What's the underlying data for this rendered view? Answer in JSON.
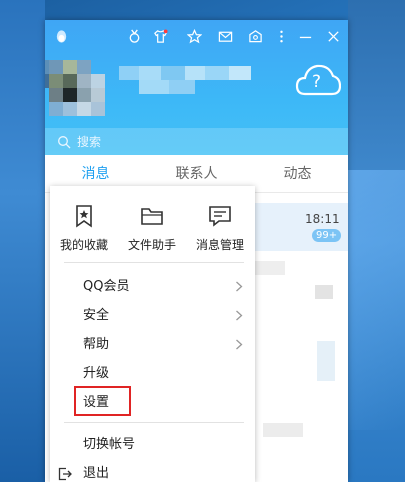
{
  "window": {
    "titlebar_icons": [
      "penguin-icon",
      "medal-icon",
      "shirt-icon",
      "star-icon",
      "mail-icon",
      "app-box-icon",
      "more-icon",
      "minimize-icon",
      "close-icon"
    ],
    "weather_label": "?"
  },
  "search": {
    "placeholder": "搜索"
  },
  "tabs": [
    {
      "label": "消息",
      "active": true
    },
    {
      "label": "联系人",
      "active": false
    },
    {
      "label": "动态",
      "active": false
    }
  ],
  "conversation": {
    "time": "18:11",
    "unread": "99+"
  },
  "menu": {
    "quick_actions": [
      {
        "label": "我的收藏",
        "icon": "bookmark-icon"
      },
      {
        "label": "文件助手",
        "icon": "folder-icon"
      },
      {
        "label": "消息管理",
        "icon": "message-manage-icon"
      }
    ],
    "items": [
      {
        "label": "QQ会员",
        "has_submenu": true
      },
      {
        "label": "安全",
        "has_submenu": true
      },
      {
        "label": "帮助",
        "has_submenu": true
      },
      {
        "label": "升级",
        "has_submenu": false
      },
      {
        "label": "设置",
        "has_submenu": false,
        "highlighted": true
      },
      {
        "label": "切换帐号",
        "has_submenu": false
      },
      {
        "label": "退出",
        "has_submenu": false,
        "icon": "exit-icon"
      }
    ]
  },
  "colors": {
    "header": "#3db8f7",
    "accent": "#1fa0f0",
    "highlight_border": "#e02424"
  }
}
